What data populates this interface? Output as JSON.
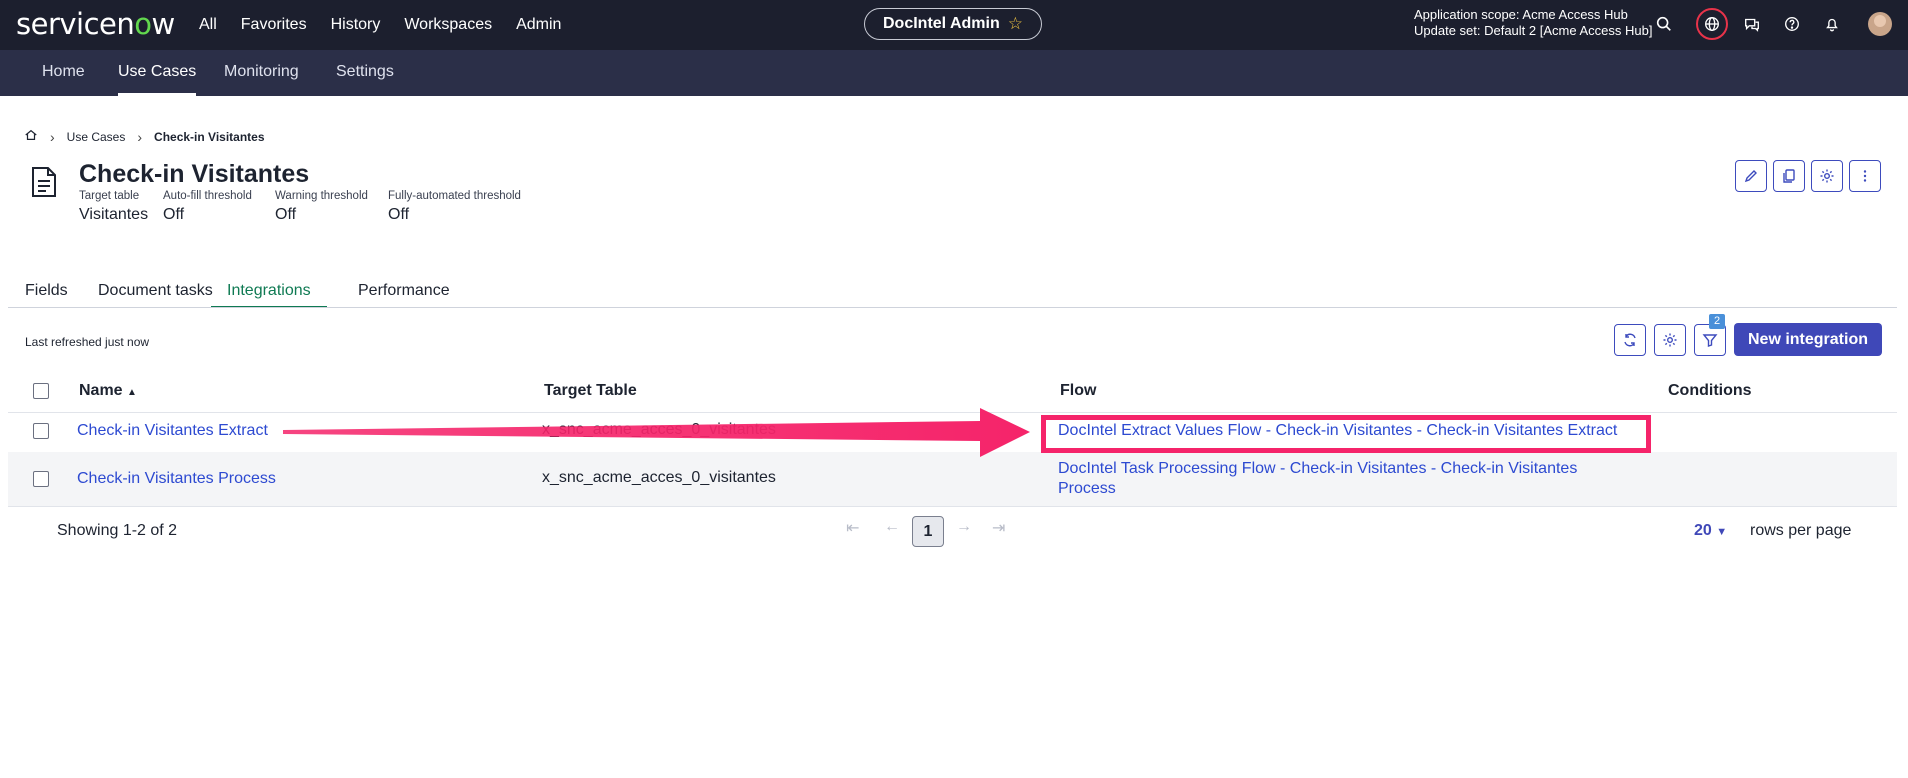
{
  "topbar": {
    "logo": "servicenow",
    "nav": [
      "All",
      "Favorites",
      "History",
      "Workspaces",
      "Admin"
    ],
    "workspace_pill": "DocIntel Admin",
    "app_scope": "Application scope: Acme Access Hub",
    "update_set": "Update set: Default 2 [Acme Access Hub]"
  },
  "subnav": {
    "tabs": [
      "Home",
      "Use Cases",
      "Monitoring",
      "Settings"
    ],
    "active": "Use Cases"
  },
  "breadcrumb": {
    "items": [
      "Use Cases",
      "Check-in Visitantes"
    ]
  },
  "header": {
    "title": "Check-in Visitantes",
    "meta": [
      {
        "label": "Target table",
        "value": "Visitantes"
      },
      {
        "label": "Auto-fill threshold",
        "value": "Off"
      },
      {
        "label": "Warning threshold",
        "value": "Off"
      },
      {
        "label": "Fully-automated threshold",
        "value": "Off"
      }
    ]
  },
  "tabs": {
    "items": [
      "Fields",
      "Document tasks",
      "Integrations",
      "Performance"
    ],
    "active": "Integrations"
  },
  "toolbar": {
    "refreshed": "Last refreshed just now",
    "filter_count": "2",
    "new_button": "New integration"
  },
  "table": {
    "columns": [
      "Name",
      "Target Table",
      "Flow",
      "Conditions"
    ],
    "sort_indicator": "▲",
    "rows": [
      {
        "name": "Check-in Visitantes Extract",
        "target_table": "x_snc_acme_acces_0_visitantes",
        "flow": "DocIntel Extract Values Flow - Check-in Visitantes - Check-in Visitantes Extract",
        "conditions": ""
      },
      {
        "name": "Check-in Visitantes Process",
        "target_table": "x_snc_acme_acces_0_visitantes",
        "flow_line1": "DocIntel Task Processing Flow - Check-in Visitantes - Check-in Visitantes",
        "flow_line2": "Process",
        "conditions": ""
      }
    ]
  },
  "footer": {
    "showing": "Showing 1-2 of 2",
    "current_page": "1",
    "rows_per_page_value": "20",
    "rows_per_page_label": "rows per page"
  },
  "colors": {
    "topbar": "#1c1f2e",
    "subnav": "#2b2f48",
    "primary": "#3f48b8",
    "link": "#2d4ad1",
    "active_tab": "#0f7a53",
    "annotation": "#f5246a"
  }
}
